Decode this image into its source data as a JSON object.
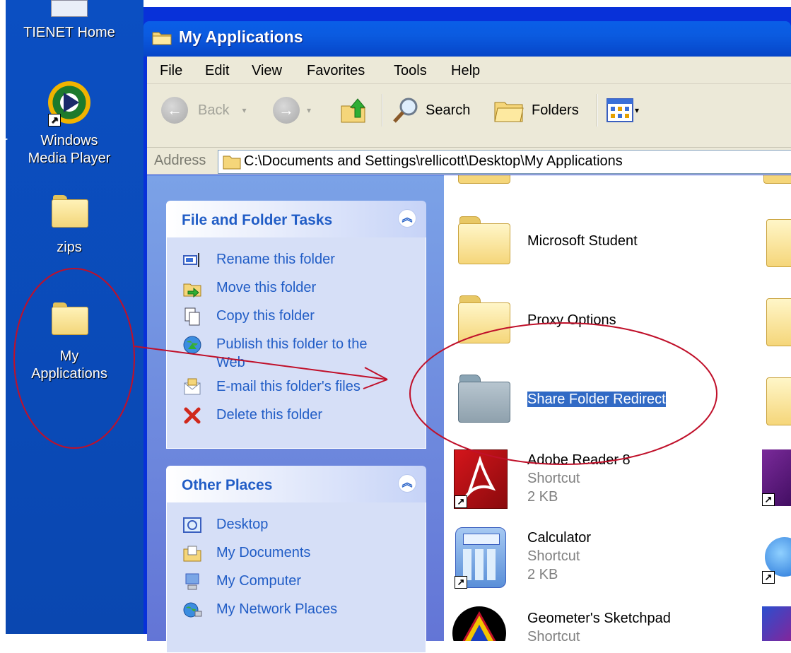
{
  "desktop": {
    "icons": [
      {
        "label": "TIENET Home"
      },
      {
        "label_line1": "Windows",
        "label_line2": "Media Player"
      },
      {
        "label": "zips"
      },
      {
        "label_line1": "My",
        "label_line2": "Applications"
      }
    ],
    "edge_char": "r",
    "background_color": "#0a48b8"
  },
  "window": {
    "title": "My Applications",
    "menu": [
      "File",
      "Edit",
      "View",
      "Favorites",
      "Tools",
      "Help"
    ],
    "toolbar": {
      "back_label": "Back",
      "search_label": "Search",
      "folders_label": "Folders"
    },
    "address": {
      "label": "Address",
      "path": "C:\\Documents and Settings\\rellicott\\Desktop\\My Applications"
    }
  },
  "taskpane": {
    "file_tasks": {
      "title": "File and Folder Tasks",
      "items": [
        {
          "label": "Rename this folder",
          "icon": "rename-icon"
        },
        {
          "label": "Move this folder",
          "icon": "move-icon"
        },
        {
          "label": "Copy this folder",
          "icon": "copy-icon"
        },
        {
          "label_line1": "Publish this folder to the",
          "label_line2": "Web",
          "icon": "publish-web-icon"
        },
        {
          "label": "E-mail this folder's files",
          "icon": "email-icon"
        },
        {
          "label": "Delete this folder",
          "icon": "delete-icon"
        }
      ]
    },
    "other_places": {
      "title": "Other Places",
      "items": [
        {
          "label": "Desktop",
          "icon": "desktop-icon"
        },
        {
          "label": "My Documents",
          "icon": "my-documents-icon"
        },
        {
          "label": "My Computer",
          "icon": "my-computer-icon"
        },
        {
          "label": "My Network Places",
          "icon": "network-places-icon"
        }
      ]
    }
  },
  "files": [
    {
      "name": "Microsoft Student",
      "type": "folder"
    },
    {
      "name": "Proxy Options",
      "type": "folder"
    },
    {
      "name": "Share Folder Redirect",
      "type": "folder",
      "selected": true
    },
    {
      "name": "Adobe Reader 8",
      "line2": "Shortcut",
      "line3": "2 KB",
      "type": "shortcut"
    },
    {
      "name": "Calculator",
      "line2": "Shortcut",
      "line3": "2 KB",
      "type": "shortcut"
    },
    {
      "name": "Geometer's Sketchpad",
      "line2": "Shortcut",
      "type": "shortcut"
    }
  ],
  "colors": {
    "task_link": "#215dc6",
    "selection": "#316ac5",
    "annotation": "#c0102a",
    "titlebar": "#0a5ee8"
  }
}
